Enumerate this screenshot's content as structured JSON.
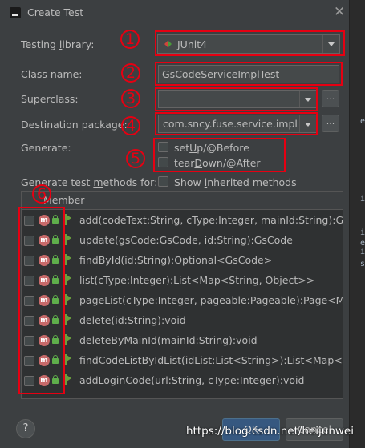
{
  "window": {
    "title": "Create Test",
    "close_icon": "close-icon"
  },
  "code_strip": [
    "e",
    "i",
    "i",
    "e",
    "i",
    "s"
  ],
  "form": {
    "testing_library": {
      "label_pre": "Testing ",
      "label_mn": "l",
      "label_post": "ibrary:",
      "value": "JUnit4"
    },
    "class_name": {
      "label": "Class name:",
      "value": "GsCodeServiceImplTest"
    },
    "superclass": {
      "label": "Superclass:",
      "value": "",
      "browse_label": "..."
    },
    "destination_package": {
      "label": "Destination package:",
      "value": "com.sncy.fuse.service.impl",
      "browse_label": "..."
    },
    "generate": {
      "label": "Generate:",
      "setup": {
        "pre": "set",
        "mn": "U",
        "post": "p/@Before",
        "checked": false
      },
      "teardown": {
        "pre": "tear",
        "mn": "D",
        "post": "own/@After",
        "checked": false
      }
    },
    "methods_label": {
      "pre": "Generate test ",
      "mn": "m",
      "post": "ethods for:"
    },
    "show_inherited": {
      "pre": "Show ",
      "mn": "i",
      "post": "nherited methods",
      "checked": false
    }
  },
  "members_table": {
    "header": "Member",
    "rows": [
      {
        "signature": "add(codeText:String, cType:Integer, mainId:String):GsCod",
        "checked": false
      },
      {
        "signature": "update(gsCode:GsCode, id:String):GsCode",
        "checked": false
      },
      {
        "signature": "findById(id:String):Optional<GsCode>",
        "checked": false
      },
      {
        "signature": "list(cType:Integer):List<Map<String, Object>>",
        "checked": false
      },
      {
        "signature": "pageList(cType:Integer, pageable:Pageable):Page<Map<",
        "checked": false
      },
      {
        "signature": "delete(id:String):void",
        "checked": false
      },
      {
        "signature": "deleteByMainId(mainId:String):void",
        "checked": false
      },
      {
        "signature": "findCodeListByIdList(idList:List<String>):List<Map<Strin",
        "checked": false
      },
      {
        "signature": "addLoginCode(url:String, cType:Integer):void",
        "checked": false
      }
    ]
  },
  "annotations": [
    "1",
    "2",
    "3",
    "4",
    "5",
    "6"
  ],
  "footer": {
    "help_label": "?",
    "ok_label": "OK",
    "cancel_label": "Cancel"
  },
  "watermark": "https://blog.csdn.net/heijunwei",
  "colors": {
    "annotation_red": "#e60012",
    "ok_blue": "#365880",
    "junit_green": "#4a9a3a",
    "junit_red": "#d0453c"
  }
}
